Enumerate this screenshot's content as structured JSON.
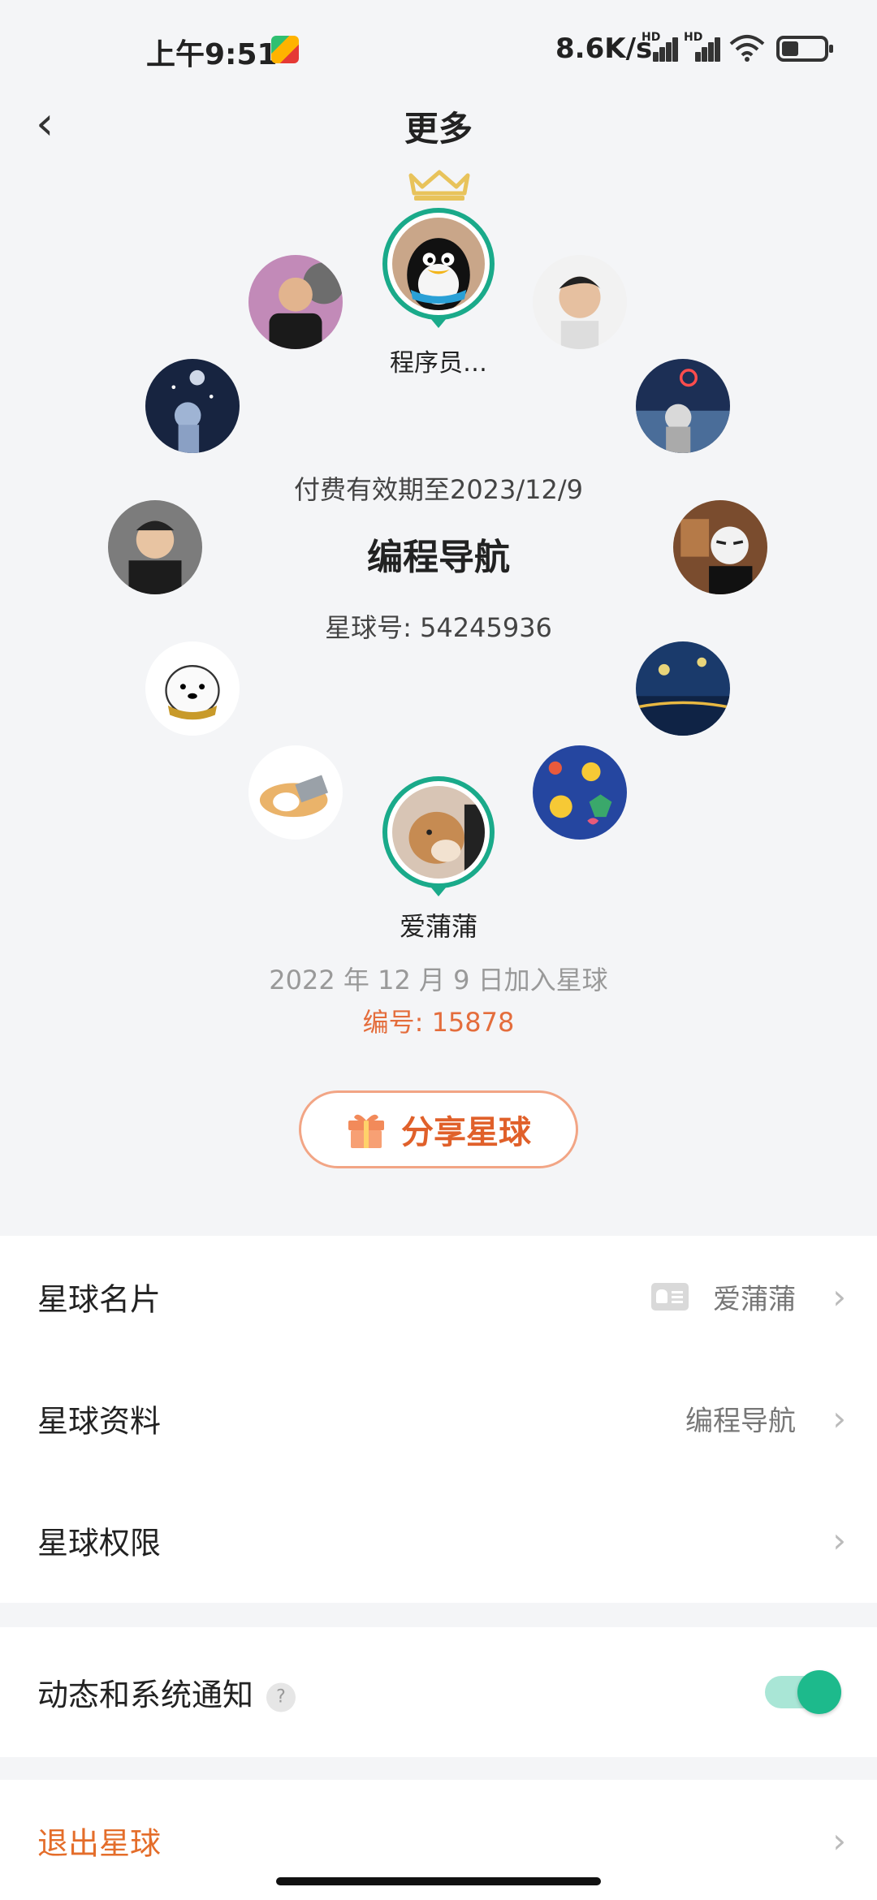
{
  "status_bar": {
    "time": "上午9:51",
    "net_speed": "8.6K/s",
    "sim1_label": "HD",
    "sim2_label": "HD"
  },
  "header": {
    "title": "更多",
    "back_icon": "back-chevron-icon"
  },
  "circle": {
    "owner_name": "程序员…",
    "expire_text": "付费有效期至2023/12/9",
    "planet_name": "编程导航",
    "planet_id": "星球号: 54245936",
    "member_name": "爱蒲蒲",
    "join_text": "2022 年 12 月 9 日加入星球",
    "member_number": "编号: 15878"
  },
  "share_button": {
    "label": "分享星球",
    "icon": "gift-icon"
  },
  "settings_group1": [
    {
      "label": "星球名片",
      "value": "爱蒲蒲"
    },
    {
      "label": "星球资料",
      "value": "编程导航"
    },
    {
      "label": "星球权限",
      "value": ""
    }
  ],
  "notification": {
    "label": "动态和系统通知",
    "help": "?",
    "enabled": true
  },
  "exit": {
    "label": "退出星球"
  },
  "colors": {
    "accent_green": "#1aaa8a",
    "accent_orange": "#e46d3c",
    "background": "#f4f5f7"
  }
}
